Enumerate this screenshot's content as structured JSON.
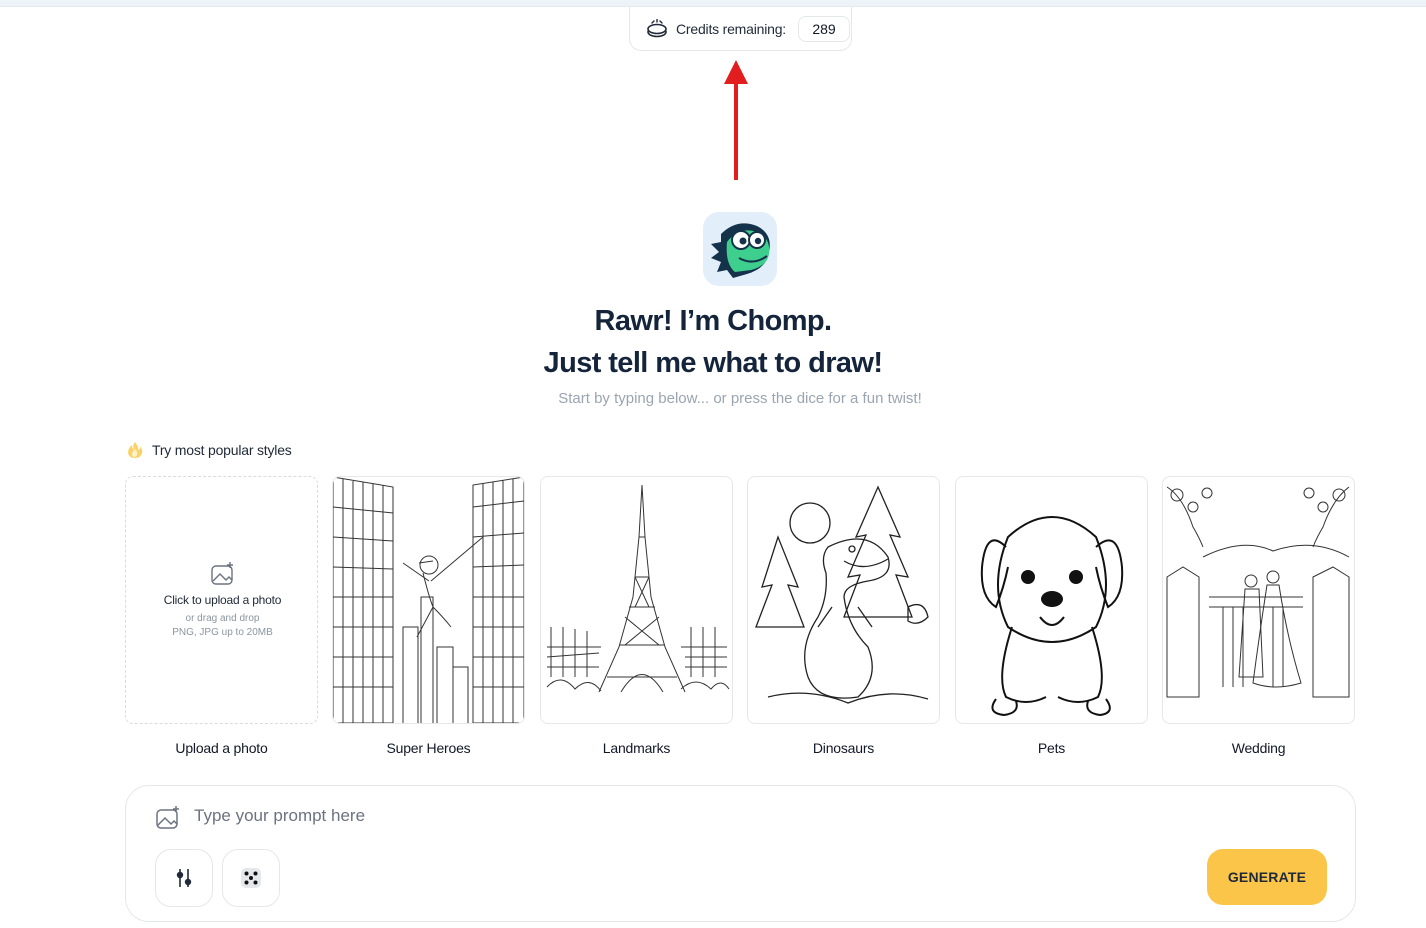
{
  "credits": {
    "label": "Credits remaining:",
    "count": "289"
  },
  "hero": {
    "line1": "Rawr! I’m Chomp.",
    "line2": "Just tell me what to draw!",
    "subtitle": "Start by typing below... or press the dice for a fun twist!"
  },
  "styles": {
    "title": "Try most popular styles",
    "upload": {
      "title": "Click to upload a photo",
      "hint": "or drag and drop",
      "formats": "PNG, JPG up to 20MB",
      "caption": "Upload a photo"
    },
    "cards": [
      {
        "caption": "Super Heroes"
      },
      {
        "caption": "Landmarks"
      },
      {
        "caption": "Dinosaurs"
      },
      {
        "caption": "Pets"
      },
      {
        "caption": "Wedding"
      }
    ]
  },
  "prompt": {
    "placeholder": "Type your prompt here",
    "generate_label": "GENERATE"
  },
  "colors": {
    "accent": "#fbc54a",
    "arrow": "#e11d1d",
    "heading": "#14243a",
    "mascot_green": "#3ecf8e"
  },
  "icons": [
    "coin-icon",
    "red-arrow-icon",
    "flame-icon",
    "image-add-icon",
    "sliders-icon",
    "dice-icon"
  ]
}
